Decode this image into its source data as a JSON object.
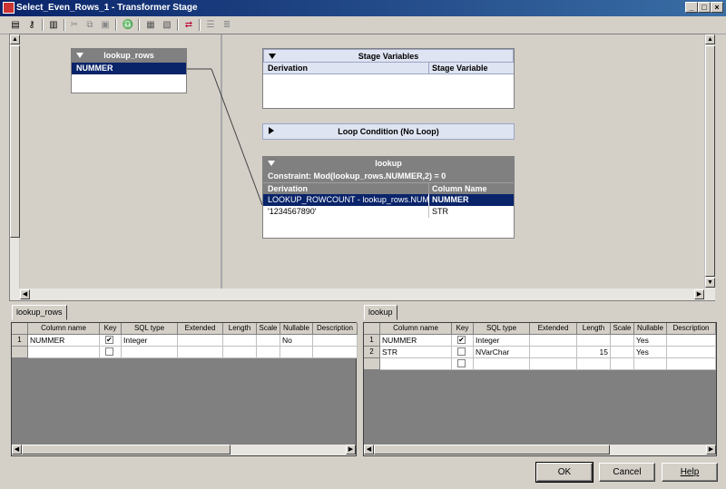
{
  "window": {
    "title": "Select_Even_Rows_1 - Transformer Stage",
    "min": "_",
    "max": "□",
    "close": "×"
  },
  "toolbar": {
    "icons": [
      "properties-icon",
      "key-icon",
      "columns-icon",
      "cut-icon",
      "copy-icon",
      "paste-icon",
      "find-icon",
      "load-icon",
      "save-icon",
      "input-order-icon",
      "output-order-icon",
      "left-align-icon"
    ]
  },
  "input_link": {
    "name": "lookup_rows",
    "rows": [
      "NUMMER"
    ]
  },
  "stage_vars": {
    "title": "Stage Variables",
    "col1": "Derivation",
    "col2": "Stage Variable"
  },
  "loop": {
    "title": "Loop Condition (No Loop)"
  },
  "output_link": {
    "name": "lookup",
    "constraint": "Constraint: Mod(lookup_rows.NUMMER,2) = 0",
    "col1": "Derivation",
    "col2": "Column Name",
    "rows": [
      {
        "derivation": "LOOKUP_ROWCOUNT - lookup_rows.NUMMER",
        "column": "NUMMER"
      },
      {
        "derivation": "'1234567890'",
        "column": "STR"
      }
    ]
  },
  "left_grid": {
    "tab": "lookup_rows",
    "headers": [
      "Column name",
      "Key",
      "SQL type",
      "Extended",
      "Length",
      "Scale",
      "Nullable",
      "Description"
    ],
    "rows": [
      {
        "num": "1",
        "name": "NUMMER",
        "key": "✔",
        "sql": "Integer",
        "ext": "",
        "len": "",
        "scale": "",
        "null": "No",
        "desc": ""
      },
      {
        "num": "",
        "name": "",
        "key": "",
        "sql": "",
        "ext": "",
        "len": "",
        "scale": "",
        "null": "",
        "desc": ""
      }
    ]
  },
  "right_grid": {
    "tab": "lookup",
    "headers": [
      "Column name",
      "Key",
      "SQL type",
      "Extended",
      "Length",
      "Scale",
      "Nullable",
      "Description"
    ],
    "rows": [
      {
        "num": "1",
        "name": "NUMMER",
        "key": "✔",
        "sql": "Integer",
        "ext": "",
        "len": "",
        "scale": "",
        "null": "Yes",
        "desc": ""
      },
      {
        "num": "2",
        "name": "STR",
        "key": "",
        "sql": "NVarChar",
        "ext": "",
        "len": "15",
        "scale": "",
        "null": "Yes",
        "desc": ""
      },
      {
        "num": "",
        "name": "",
        "key": "",
        "sql": "",
        "ext": "",
        "len": "",
        "scale": "",
        "null": "",
        "desc": ""
      }
    ]
  },
  "buttons": {
    "ok": "OK",
    "cancel": "Cancel",
    "help": "Help"
  }
}
